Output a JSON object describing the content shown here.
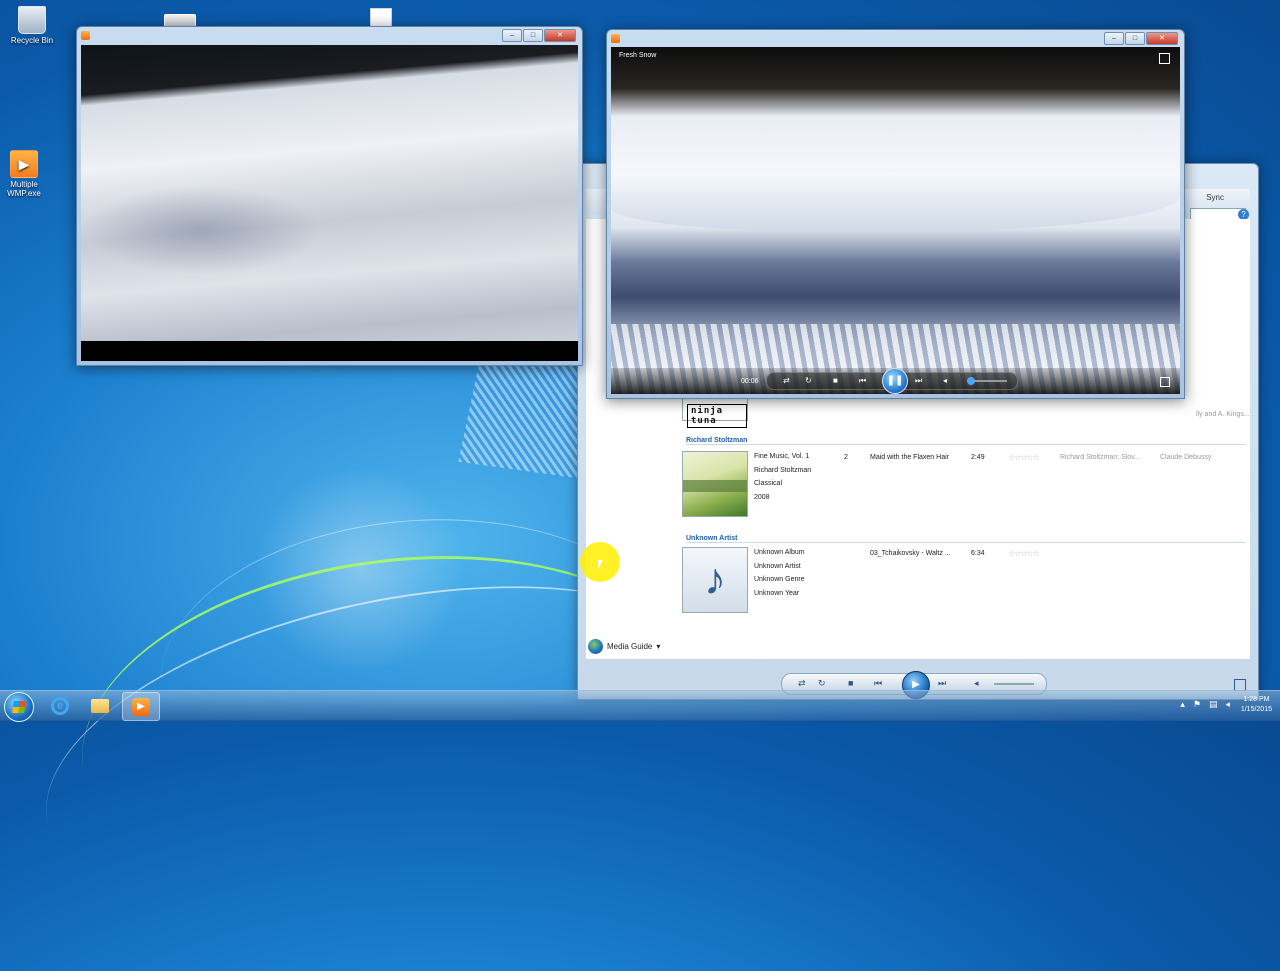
{
  "desktop": {
    "icons": [
      {
        "label": "Recycle Bin"
      },
      {
        "label": "Multiple WMP.exe"
      }
    ]
  },
  "library": {
    "sync_label": "Sync",
    "rows": [
      {
        "artist": "Richard Stoltzman",
        "album": "Fine Music, Vol. 1",
        "album_artist": "Richard Stoltzman",
        "genre": "Classical",
        "year": "2008",
        "track_no": "2",
        "title": "Maid with the Flaxen Hair",
        "length": "2:49",
        "contributing_artist": "Richard Stoltzman; Slov...",
        "composer": "Claude Debussy"
      },
      {
        "artist": "Unknown Artist",
        "album": "Unknown Album",
        "album_artist": "Unknown Artist",
        "genre": "Unknown Genre",
        "year": "Unknown Year",
        "track_no": "",
        "title": "03_Tchaikovsky - Waltz ...",
        "length": "6:34",
        "contributing_artist": "",
        "composer": ""
      }
    ],
    "partial_artist_text": "lly and A. Kings...",
    "ninja_art_text": "ninja tuna",
    "media_guide_label": "Media Guide"
  },
  "player2": {
    "video_title": "Fresh Snow",
    "time": "00:06"
  },
  "taskbar": {
    "clock_time": "1:28 PM",
    "clock_date": "1/15/2015"
  }
}
